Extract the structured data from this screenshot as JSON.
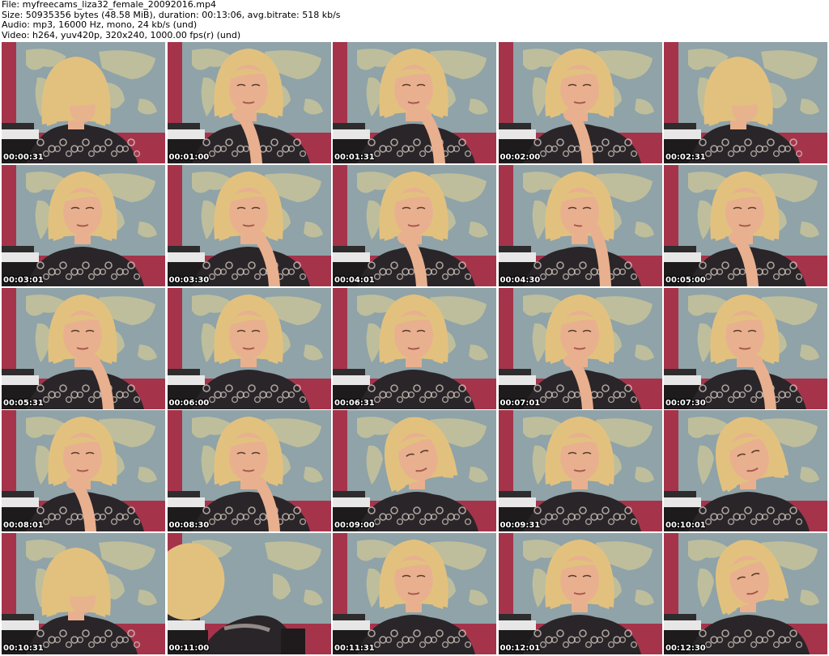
{
  "header": {
    "file_line": "File: myfreecams_liza32_female_20092016.mp4",
    "size_line": "Size: 50935356 bytes (48.58 MiB), duration: 00:13:06, avg.bitrate: 518 kb/s",
    "audio_line": "Audio: mp3, 16000 Hz, mono, 24 kb/s (und)",
    "video_line": "Video: h264, yuv420p, 320x240, 1000.00 fps(r) (und)"
  },
  "thumbnails": [
    {
      "timestamp": "00:00:31",
      "pose": "head-down"
    },
    {
      "timestamp": "00:01:00",
      "pose": "hand-chin"
    },
    {
      "timestamp": "00:01:31",
      "pose": "hand-chin"
    },
    {
      "timestamp": "00:02:00",
      "pose": "hand-chin"
    },
    {
      "timestamp": "00:02:31",
      "pose": "head-down"
    },
    {
      "timestamp": "00:03:01",
      "pose": "neutral"
    },
    {
      "timestamp": "00:03:30",
      "pose": "hand-chin"
    },
    {
      "timestamp": "00:04:01",
      "pose": "hand-chin"
    },
    {
      "timestamp": "00:04:30",
      "pose": "hand-mouth"
    },
    {
      "timestamp": "00:05:00",
      "pose": "hand-chin"
    },
    {
      "timestamp": "00:05:31",
      "pose": "hand-chin"
    },
    {
      "timestamp": "00:06:00",
      "pose": "neutral"
    },
    {
      "timestamp": "00:06:31",
      "pose": "neutral"
    },
    {
      "timestamp": "00:07:01",
      "pose": "hand-chin"
    },
    {
      "timestamp": "00:07:30",
      "pose": "hand-chin"
    },
    {
      "timestamp": "00:08:01",
      "pose": "hand-chin"
    },
    {
      "timestamp": "00:08:30",
      "pose": "hand-chin"
    },
    {
      "timestamp": "00:09:00",
      "pose": "tilted"
    },
    {
      "timestamp": "00:09:31",
      "pose": "neutral"
    },
    {
      "timestamp": "00:10:01",
      "pose": "tilted"
    },
    {
      "timestamp": "00:10:31",
      "pose": "head-down"
    },
    {
      "timestamp": "00:11:00",
      "pose": "leaning-out"
    },
    {
      "timestamp": "00:11:31",
      "pose": "neutral"
    },
    {
      "timestamp": "00:12:01",
      "pose": "neutral"
    },
    {
      "timestamp": "00:12:30",
      "pose": "tilted"
    }
  ],
  "colors": {
    "map_ocean": "#8fa3a8",
    "map_land": "#c7c39a",
    "wall_red": "#a5344b",
    "hair": "#e2c17f",
    "skin": "#e8b08f",
    "dress": "#2a2528",
    "dress_pattern": "#d8cfc6",
    "timestamp_text": "#ffffff"
  }
}
